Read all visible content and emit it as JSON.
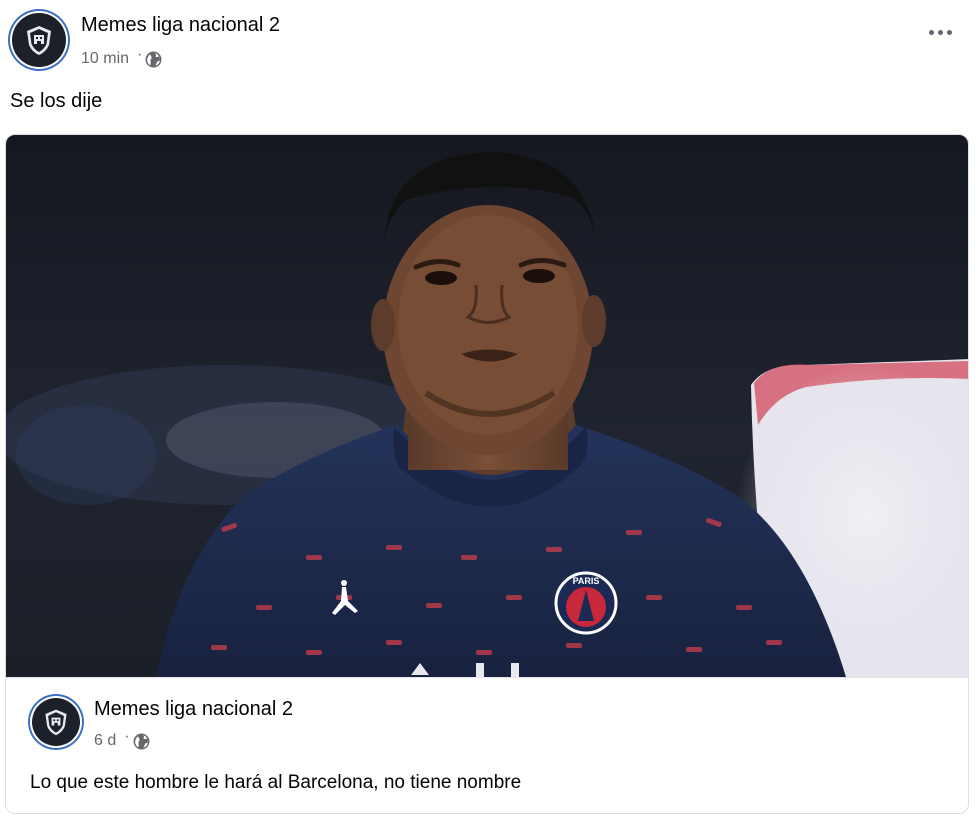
{
  "post": {
    "page_name": "Memes liga nacional 2",
    "timestamp": "10 min",
    "separator": "·",
    "audience_icon": "globe-icon",
    "more_icon": "more-options-icon",
    "caption": "Se los dije"
  },
  "shared_post": {
    "page_name": "Memes liga nacional 2",
    "timestamp": "6 d",
    "separator": "·",
    "audience_icon": "globe-icon",
    "text": "Lo que este hombre le hará al Barcelona, no tiene nombre"
  },
  "photo": {
    "subject": "footballer-portrait",
    "jersey_crest_text": "PARIS",
    "colors": {
      "jersey": "#1f2e52",
      "accent": "#c8283a",
      "background": "#181c24"
    }
  }
}
